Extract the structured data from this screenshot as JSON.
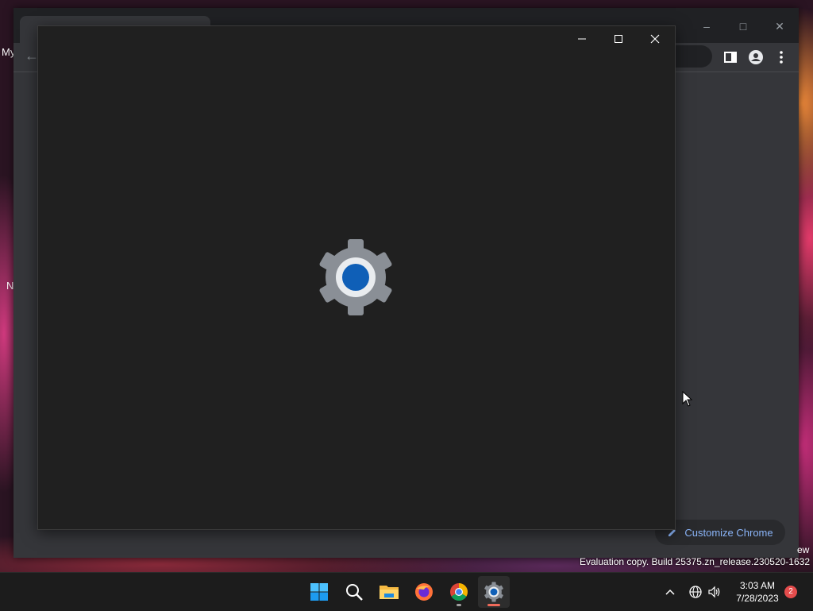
{
  "desktop": {
    "fragments": [
      "My",
      "N"
    ]
  },
  "chrome": {
    "customize_label": "Customize Chrome",
    "watermark": "Evaluation copy. Build 25375.zn_release.230520-1632",
    "watermark_tail": "ew"
  },
  "settings_window": {
    "splash_icon": "settings-gear-icon",
    "accent": "#0f5fb7"
  },
  "taskbar": {
    "items": [
      {
        "name": "start",
        "icon": "windows-logo-icon"
      },
      {
        "name": "search",
        "icon": "search-icon"
      },
      {
        "name": "file-explorer",
        "icon": "folder-icon"
      },
      {
        "name": "firefox",
        "icon": "firefox-icon"
      },
      {
        "name": "chrome",
        "icon": "chrome-icon"
      },
      {
        "name": "settings",
        "icon": "settings-gear-icon"
      }
    ],
    "clock_time": "3:03 AM",
    "clock_date": "7/28/2023",
    "notification_count": "2"
  }
}
